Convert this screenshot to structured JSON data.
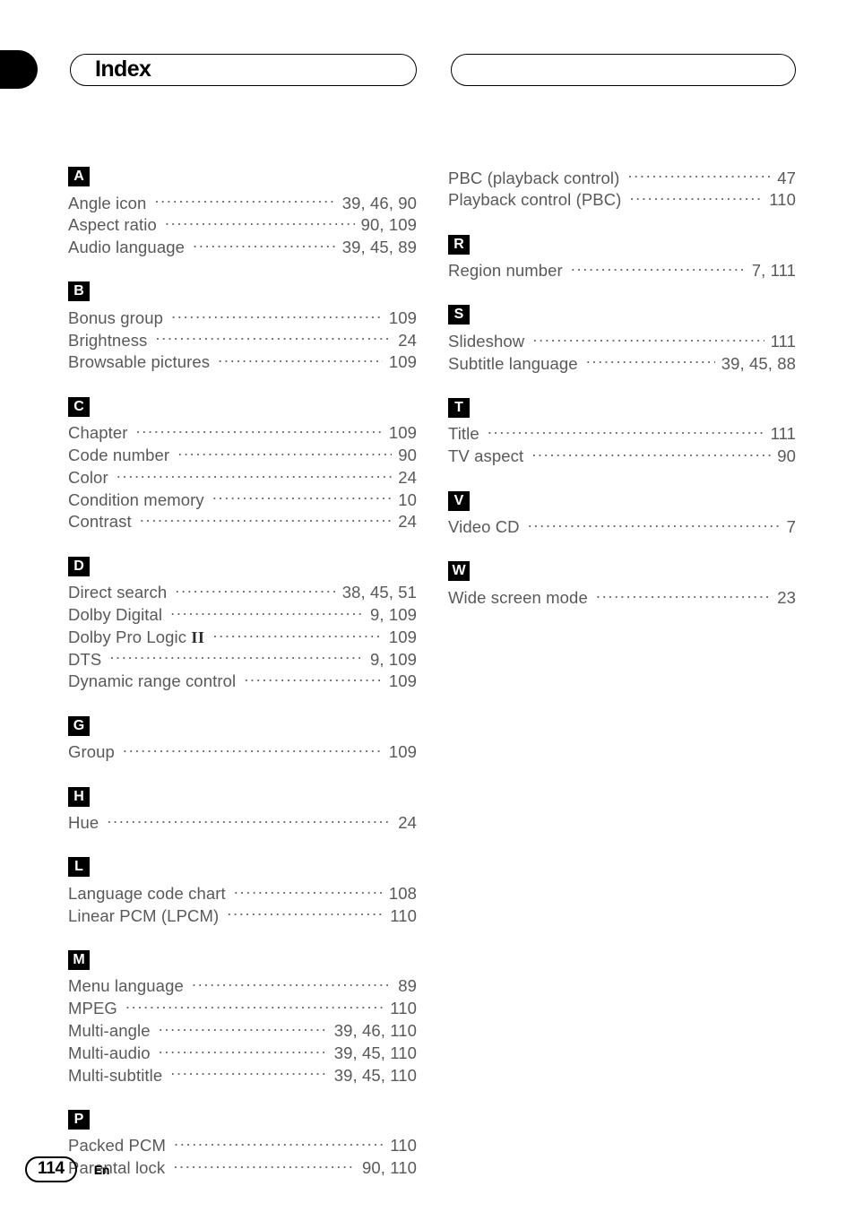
{
  "page": {
    "title": "Index",
    "right_header_title": "",
    "number": "114",
    "language_code": "En"
  },
  "columns": {
    "left": [
      {
        "letter": "A",
        "entries": [
          {
            "term": "Angle icon",
            "pages": "39, 46, 90"
          },
          {
            "term": "Aspect ratio",
            "pages": "90, 109"
          },
          {
            "term": "Audio language",
            "pages": "39, 45, 89"
          }
        ]
      },
      {
        "letter": "B",
        "entries": [
          {
            "term": "Bonus group",
            "pages": "109"
          },
          {
            "term": "Brightness",
            "pages": "24"
          },
          {
            "term": "Browsable pictures",
            "pages": "109"
          }
        ]
      },
      {
        "letter": "C",
        "entries": [
          {
            "term": "Chapter",
            "pages": "109"
          },
          {
            "term": "Code number",
            "pages": "90"
          },
          {
            "term": "Color",
            "pages": "24"
          },
          {
            "term": "Condition memory",
            "pages": "10"
          },
          {
            "term": "Contrast",
            "pages": "24"
          }
        ]
      },
      {
        "letter": "D",
        "entries": [
          {
            "term": "Direct search",
            "pages": "38, 45, 51"
          },
          {
            "term": "Dolby Digital",
            "pages": "9, 109"
          },
          {
            "term": "Dolby Pro Logic ",
            "term_suffix": "II",
            "pages": "109"
          },
          {
            "term": "DTS",
            "pages": "9, 109"
          },
          {
            "term": "Dynamic range control",
            "pages": "109"
          }
        ]
      },
      {
        "letter": "G",
        "entries": [
          {
            "term": "Group",
            "pages": "109"
          }
        ]
      },
      {
        "letter": "H",
        "entries": [
          {
            "term": "Hue",
            "pages": "24"
          }
        ]
      },
      {
        "letter": "L",
        "entries": [
          {
            "term": "Language code chart",
            "pages": "108"
          },
          {
            "term": "Linear PCM (LPCM)",
            "pages": "110"
          }
        ]
      },
      {
        "letter": "M",
        "entries": [
          {
            "term": "Menu language",
            "pages": "89"
          },
          {
            "term": "MPEG",
            "pages": "110"
          },
          {
            "term": "Multi-angle",
            "pages": "39, 46, 110"
          },
          {
            "term": "Multi-audio",
            "pages": "39, 45, 110"
          },
          {
            "term": "Multi-subtitle",
            "pages": "39, 45, 110"
          }
        ]
      },
      {
        "letter": "P",
        "entries": [
          {
            "term": "Packed PCM",
            "pages": "110"
          },
          {
            "term": "Parental lock",
            "pages": "90, 110"
          }
        ]
      }
    ],
    "right": [
      {
        "letter": "",
        "entries": [
          {
            "term": "PBC (playback control)",
            "pages": "47"
          },
          {
            "term": "Playback control (PBC)",
            "pages": "110"
          }
        ]
      },
      {
        "letter": "R",
        "entries": [
          {
            "term": "Region number",
            "pages": "7, 111"
          }
        ]
      },
      {
        "letter": "S",
        "entries": [
          {
            "term": "Slideshow",
            "pages": "111"
          },
          {
            "term": "Subtitle language",
            "pages": "39, 45, 88"
          }
        ]
      },
      {
        "letter": "T",
        "entries": [
          {
            "term": "Title",
            "pages": "111"
          },
          {
            "term": "TV aspect",
            "pages": "90"
          }
        ]
      },
      {
        "letter": "V",
        "entries": [
          {
            "term": "Video CD",
            "pages": "7"
          }
        ]
      },
      {
        "letter": "W",
        "entries": [
          {
            "term": "Wide screen mode",
            "pages": "23"
          }
        ]
      }
    ]
  },
  "colors": {
    "text": "#595959",
    "badge_background": "#000000",
    "badge_text": "#ffffff",
    "rule": "#000000"
  }
}
